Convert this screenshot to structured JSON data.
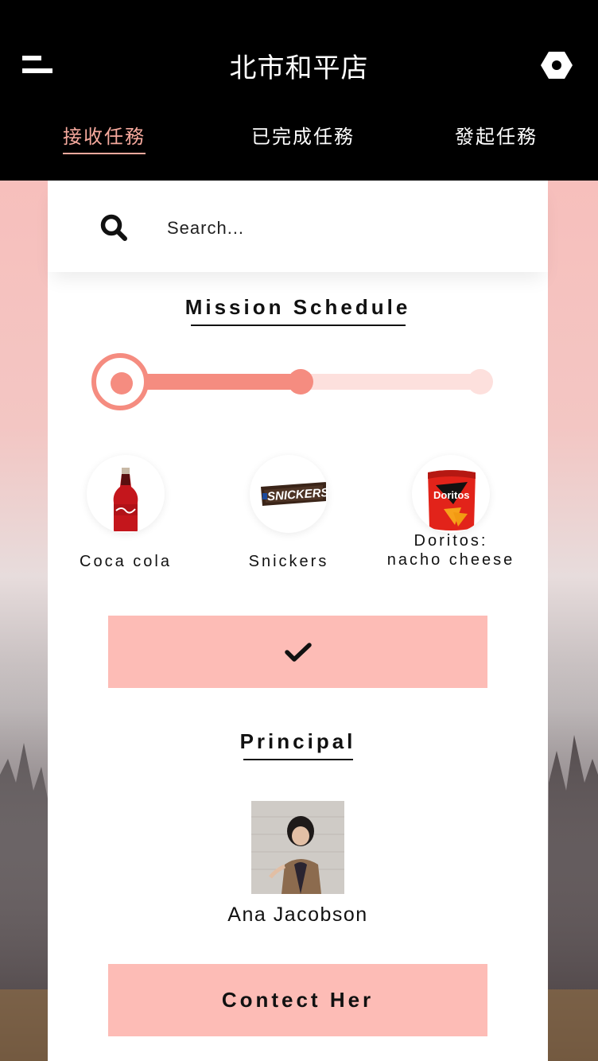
{
  "header": {
    "title": "北市和平店",
    "tabs": [
      {
        "label": "接收任務",
        "active": true
      },
      {
        "label": "已完成任務",
        "active": false
      },
      {
        "label": "發起任務",
        "active": false
      }
    ],
    "accent_color": "#f6a99d"
  },
  "search": {
    "placeholder": "Search..."
  },
  "mission": {
    "title": "Mission Schedule",
    "progress_steps": 3,
    "progress_current_step": 2,
    "progress_fraction": 0.5
  },
  "products": [
    {
      "name": "Coca cola",
      "icon": "coca-cola-bottle-icon"
    },
    {
      "name": "Snickers",
      "icon": "snickers-bar-icon"
    },
    {
      "name": "Doritos:\nnacho cheese",
      "icon": "doritos-bag-icon"
    }
  ],
  "confirm_icon": "checkmark-icon",
  "principal": {
    "title": "Principal",
    "name": "Ana Jacobson",
    "contact_label": "Contect Her"
  },
  "colors": {
    "button": "#fdbcb6",
    "progress_fill": "#f58c80",
    "progress_track": "#fde0dd"
  }
}
